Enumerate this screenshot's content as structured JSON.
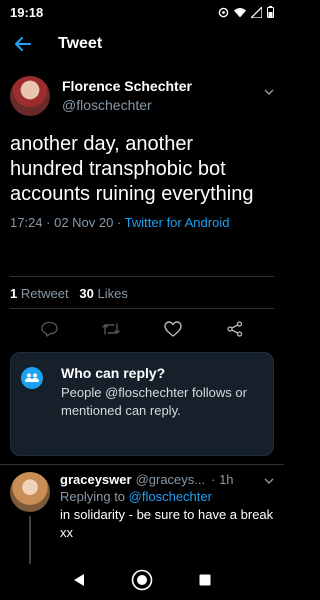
{
  "status_bar": {
    "time": "19:18"
  },
  "header": {
    "title": "Tweet"
  },
  "tweet": {
    "author_name": "Florence Schechter",
    "author_handle": "@floschechter",
    "text": "another day, another hundred transphobic bot accounts ruining everything",
    "timestamp": "17:24 · 02 Nov 20 · ",
    "source": "Twitter for Android",
    "retweets_count": "1",
    "retweets_label": "Retweet",
    "likes_count": "30",
    "likes_label": "Likes"
  },
  "who_can_reply": {
    "title": "Who can reply?",
    "description": "People @floschechter follows or mentioned can reply."
  },
  "reply": {
    "author_name": "graceyswer",
    "author_handle": "@graceys...",
    "time": "· 1h",
    "replying_prefix": "Replying to ",
    "replying_to": "@floschechter",
    "text": "in solidarity - be sure to have a break xx"
  },
  "colors": {
    "accent": "#1da1f2",
    "background": "#000000",
    "secondary_text": "#8899a6",
    "card_background": "#15202b"
  },
  "icons": {
    "status": [
      "settings-icon",
      "wifi-icon",
      "signal-icon",
      "battery-icon"
    ],
    "actions": [
      "reply-icon",
      "retweet-icon",
      "like-icon",
      "share-icon"
    ],
    "nav": [
      "back-triangle-icon",
      "home-circle-icon",
      "recents-square-icon"
    ]
  }
}
